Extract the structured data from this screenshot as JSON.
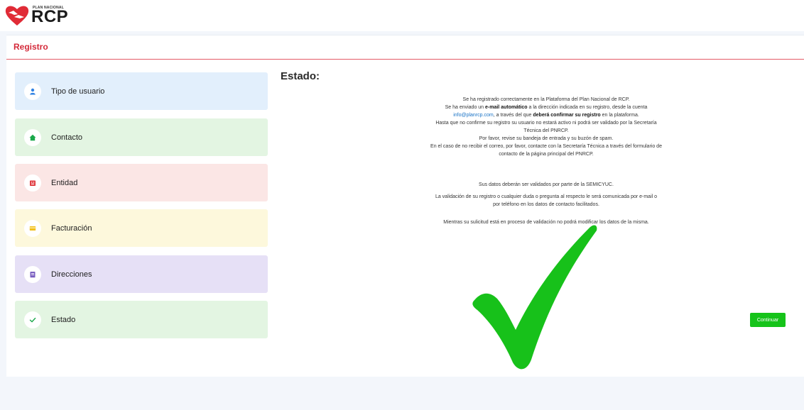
{
  "brand": {
    "small_text": "PLAN NACIONAL",
    "name": "RCP",
    "color": "#e02b36"
  },
  "card": {
    "title": "Registro"
  },
  "steps": [
    {
      "label": "Tipo de usuario",
      "icon": "person-icon",
      "bg": "#e2effc",
      "icon_color": "#2f82e3"
    },
    {
      "label": "Contacto",
      "icon": "home-icon",
      "bg": "#e3f5e2",
      "icon_color": "#1aa84a"
    },
    {
      "label": "Entidad",
      "icon": "building-icon",
      "bg": "#fbe6e5",
      "icon_color": "#e0393e"
    },
    {
      "label": "Facturación",
      "icon": "card-icon",
      "bg": "#fdf8dc",
      "icon_color": "#f2bf1d"
    },
    {
      "label": "Direcciones",
      "icon": "address-icon",
      "bg": "#e6e0f6",
      "icon_color": "#7a5fc0"
    },
    {
      "label": "Estado",
      "icon": "check-icon",
      "bg": "#e3f5e2",
      "icon_color": "#1aa84a"
    }
  ],
  "estado": {
    "title": "Estado:",
    "p1_line1": "Se ha registrado correctamente en la Plataforma del Plan Nacional de RCP.",
    "p1_line2_a": "Se ha enviado un ",
    "p1_line2_b": "e-mail automático",
    "p1_line2_c": " a la dirección indicada en su registro, desde la cuenta",
    "p1_line3_link": "info@planrcp.com",
    "p1_line3_b": ", a través del que ",
    "p1_line3_c": "deberá confirmar su registro",
    "p1_line3_d": " en la plataforma.",
    "p1_line4": "Hasta que no confirme su registro su usuario no estará activo ni podrá ser validado por la Secretaría",
    "p1_line5": "Técnica del PNRCP.",
    "p1_line6": "Por favor, revise su bandeja de entrada y su buzón de spam.",
    "p1_line7": "En el caso de no recibir el correo, por favor, contacte con la Secretaría Técnica a través del formulario de",
    "p1_line8": "contacto de la página principal del PNRCP.",
    "p2": "Sus datos deberán ser validados por parte de la SEMICYUC.",
    "p3_line1": "La validación de su registro o cualquier duda o pregunta al respecto le será comunicada por e-mail o",
    "p3_line2": "por teléfono en los datos de contacto facilitados.",
    "p4": "Mientras su sulicitud está en proceso de validación no podrá modificar los datos de la misma."
  },
  "continue_button": {
    "label": "Continuar",
    "color": "#16c31a"
  },
  "success_color": "#17c11a"
}
